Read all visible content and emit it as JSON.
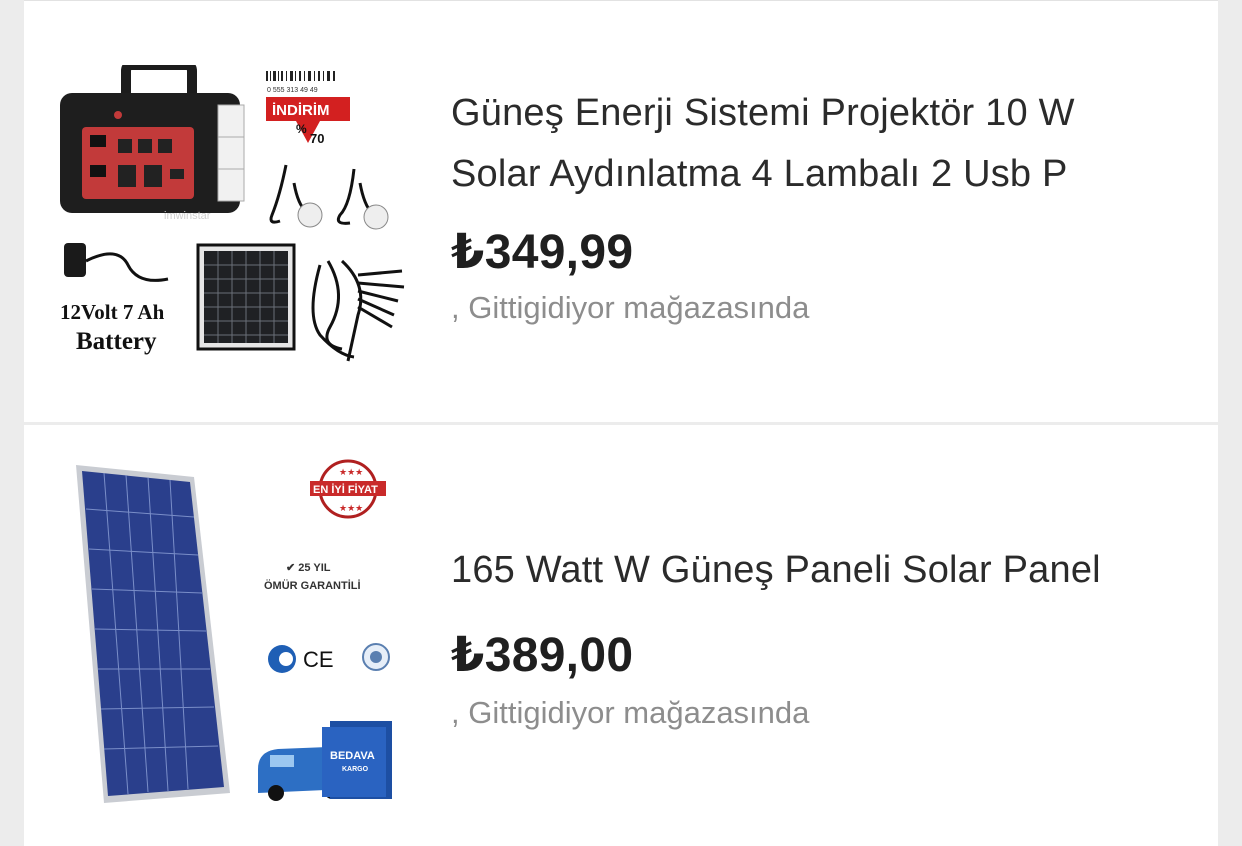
{
  "products": [
    {
      "title_line1": "Güneş Enerji Sistemi Projektör 10 W",
      "title_line2": "Solar Aydınlatma 4 Lambalı 2 Usb P",
      "price": "₺349,99",
      "seller": ", Gittigidiyor mağazasında",
      "image": {
        "barcode_digits": "0 555 313 49 49",
        "discount_label": "İNDİRİM",
        "discount_percent": "%",
        "discount_value": "70",
        "watermark": "imwinstar",
        "battery_line1": "12Volt 7 Ah",
        "battery_line2": "Battery"
      }
    },
    {
      "title": "165 Watt W Güneş Paneli Solar Panel",
      "price": "₺389,00",
      "seller": ", Gittigidiyor mağazasında",
      "image": {
        "best_price_badge": "EN İYİ FİYAT",
        "warranty_line1": "✔ 25 YIL",
        "warranty_line2": "ÖMÜR GARANTİLİ",
        "ce_mark": "CE",
        "cargo_line1": "BEDAVA",
        "cargo_line2": "KARGO"
      }
    }
  ],
  "colors": {
    "price_text": "#1f1f1f",
    "seller_text": "#8d8d8d",
    "discount_red": "#d32020",
    "panel_blue": "#2a3f8c"
  }
}
